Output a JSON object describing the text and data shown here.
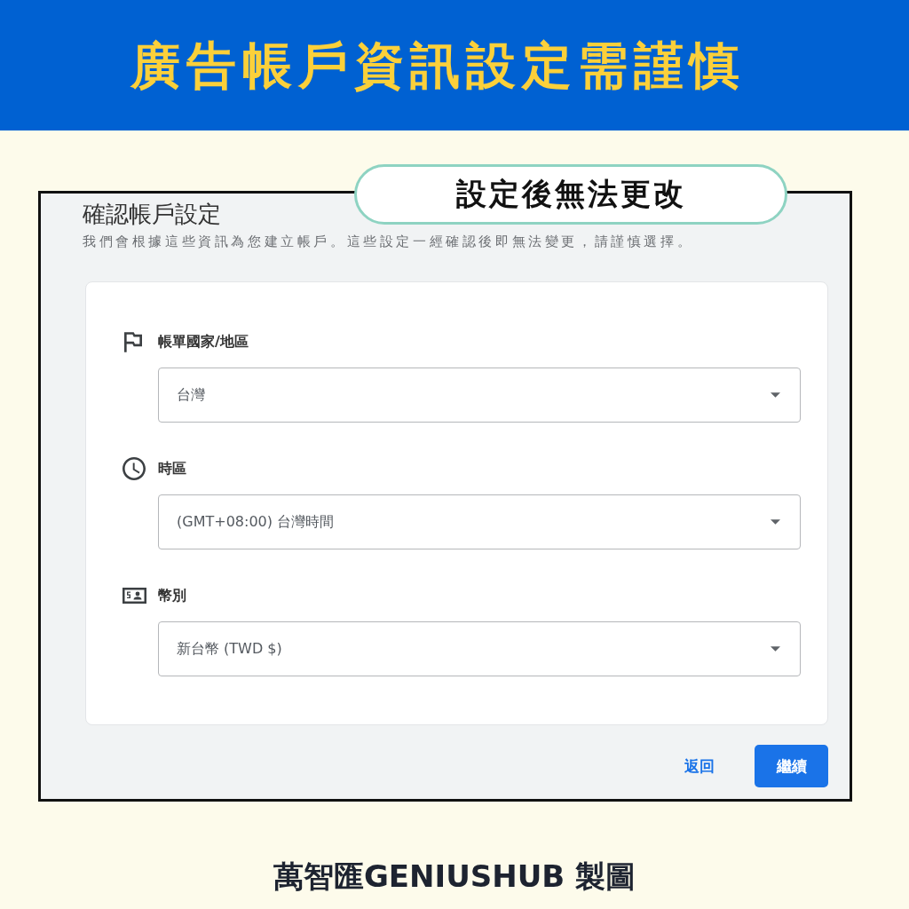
{
  "banner": {
    "title": "廣告帳戶資訊設定需謹慎"
  },
  "callout": {
    "text": "設定後無法更改"
  },
  "dialog": {
    "title": "確認帳戶設定",
    "description": "我們會根據這些資訊為您建立帳戶。這些設定一經確認後即無法變更，請謹慎選擇。",
    "fields": [
      {
        "kind": "country",
        "label": "帳單國家/地區",
        "value": "台灣"
      },
      {
        "kind": "timezone",
        "label": "時區",
        "value": "(GMT+08:00) 台灣時間"
      },
      {
        "kind": "currency",
        "label": "幣別",
        "value": "新台幣 (TWD $)"
      }
    ],
    "buttons": [
      {
        "kind": "text",
        "label": "返回"
      },
      {
        "kind": "filled",
        "label": "繼續"
      }
    ]
  },
  "credit": "萬智匯GENIUSHUB 製圖"
}
